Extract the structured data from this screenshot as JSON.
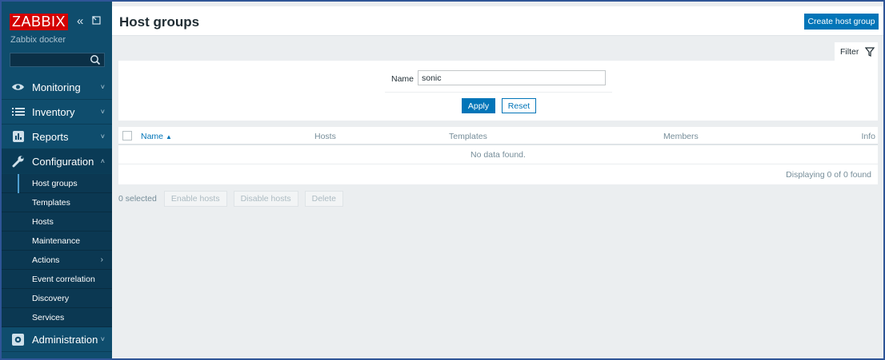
{
  "sidebar": {
    "logo": "ZABBIX",
    "server_name": "Zabbix docker",
    "search": {
      "value": "",
      "placeholder": ""
    },
    "menu": {
      "monitoring": "Monitoring",
      "inventory": "Inventory",
      "reports": "Reports",
      "configuration": "Configuration",
      "administration": "Administration"
    },
    "configuration_items": [
      {
        "label": "Host groups",
        "selected": true
      },
      {
        "label": "Templates"
      },
      {
        "label": "Hosts"
      },
      {
        "label": "Maintenance"
      },
      {
        "label": "Actions"
      },
      {
        "label": "Event correlation"
      },
      {
        "label": "Discovery"
      },
      {
        "label": "Services"
      }
    ]
  },
  "header": {
    "title": "Host groups",
    "create_button": "Create host group"
  },
  "filter": {
    "tab_label": "Filter",
    "name_label": "Name",
    "name_value": "sonic",
    "apply_label": "Apply",
    "reset_label": "Reset"
  },
  "table": {
    "columns": {
      "name": "Name",
      "hosts": "Hosts",
      "templates": "Templates",
      "members": "Members",
      "info": "Info"
    },
    "sort_indicator": "▲",
    "empty_message": "No data found.",
    "paging": "Displaying 0 of 0 found"
  },
  "actions": {
    "selected_count": "0 selected",
    "enable": "Enable hosts",
    "disable": "Disable hosts",
    "delete": "Delete"
  },
  "icons": {
    "collapse": "double-chevron-left-icon",
    "kiosk": "window-expand-icon",
    "search": "search-icon",
    "filter": "funnel-icon"
  },
  "colors": {
    "sidebar": "#0f4d6d",
    "brand": "#d40000",
    "primary": "#0275b8",
    "background": "#ebeef0"
  }
}
